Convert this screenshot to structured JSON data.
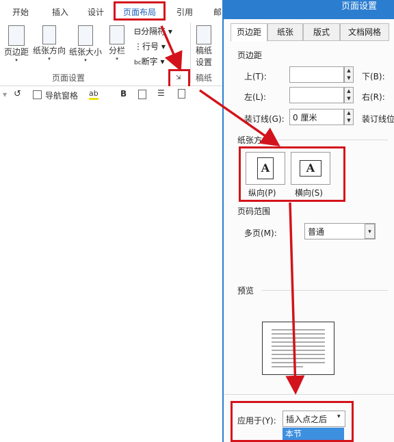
{
  "ribbon_tabs": [
    "开始",
    "插入",
    "设计",
    "页面布局",
    "引用",
    "邮"
  ],
  "ribbon_buttons": {
    "margins": "页边距",
    "orientation": "纸张方向",
    "size": "纸张大小",
    "columns": "分栏",
    "breaks": "分隔符",
    "line_numbers": "行号",
    "hyphenation": "断字",
    "draft_paper_line1": "稿纸",
    "draft_paper_line2": "设置",
    "group_label": "页面设置",
    "draft_group_label": "稿纸"
  },
  "minibar": {
    "nav_pane": "导航窗格",
    "bold": "B"
  },
  "dialog": {
    "title": "页面设置",
    "tabs": [
      "页边距",
      "纸张",
      "版式",
      "文档网格"
    ],
    "margins_section": "页边距",
    "top_label": "上(T):",
    "bottom_label": "下(B):",
    "left_label": "左(L):",
    "right_label": "右(R):",
    "gutter_label": "装订线(G):",
    "gutter_value": "0 厘米",
    "gutter_pos_label": "装订线位置",
    "orientation_section": "纸张方向",
    "portrait": "纵向(P)",
    "landscape": "横向(S)",
    "pages_section": "页码范围",
    "multiple_pages_label": "多页(M):",
    "multiple_pages_value": "普通",
    "preview_section": "预览",
    "apply_label": "应用于(Y):",
    "apply_value": "插入点之后",
    "apply_option": "本节"
  },
  "colors": {
    "accent": "#d3131b",
    "dialog_title": "#2b7dd0"
  }
}
